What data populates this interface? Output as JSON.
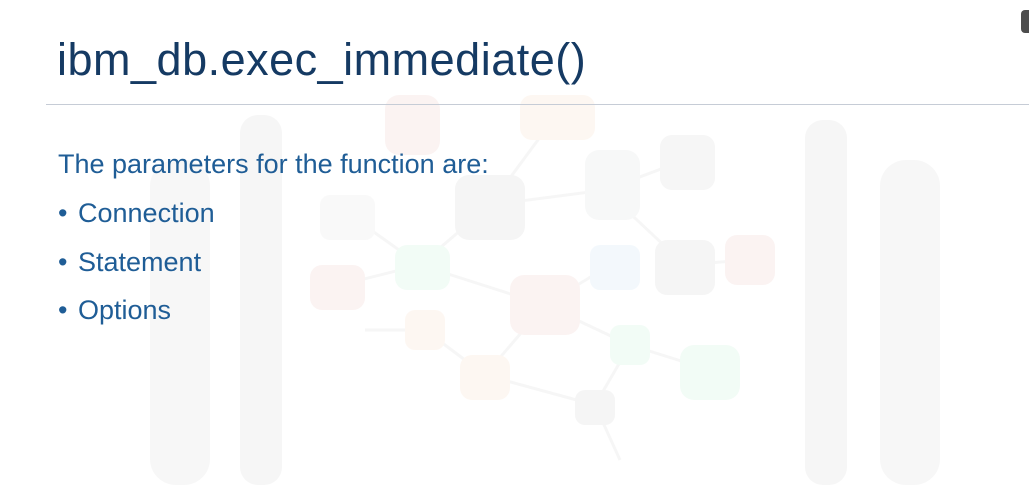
{
  "slide": {
    "title": "ibm_db.exec_immediate()",
    "intro": "The parameters for the function are:",
    "bullet_glyph": "•",
    "parameters": [
      {
        "label": "Connection"
      },
      {
        "label": "Statement"
      },
      {
        "label": "Options"
      }
    ]
  },
  "colors": {
    "title": "#153a63",
    "body_text": "#1f5d96",
    "rule": "#c6ccd6",
    "corner_tab": "#4d4d4d"
  }
}
